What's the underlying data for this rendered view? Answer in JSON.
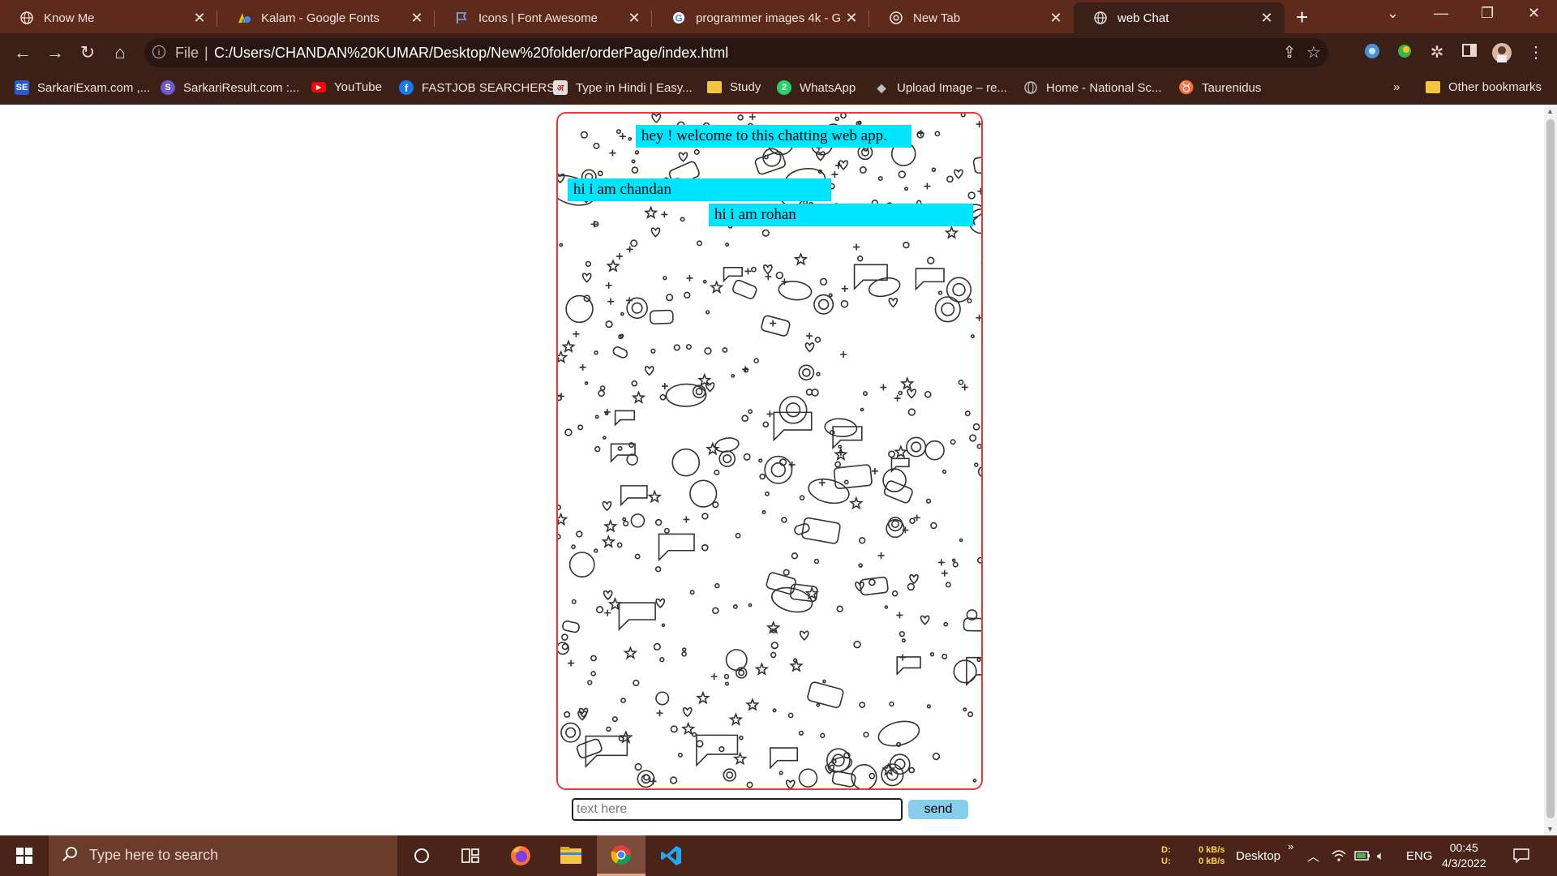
{
  "browser": {
    "tabs": [
      {
        "title": "Know Me",
        "icon": "globe-icon",
        "active": false
      },
      {
        "title": "Kalam - Google Fonts",
        "icon": "google-fonts-icon",
        "active": false
      },
      {
        "title": "Icons | Font Awesome",
        "icon": "flag-icon",
        "active": false
      },
      {
        "title": "programmer images 4k - G",
        "icon": "google-icon",
        "active": false
      },
      {
        "title": "New Tab",
        "icon": "chrome-icon",
        "active": false
      },
      {
        "title": "web Chat",
        "icon": "globe-icon",
        "active": true
      }
    ],
    "address": {
      "scheme_label": "File",
      "url": "C:/Users/CHANDAN%20KUMAR/Desktop/New%20folder/orderPage/index.html"
    },
    "bookmarks": [
      {
        "label": "SarkariExam.com ,...",
        "icon": "se-icon",
        "color": "#2a5bd7"
      },
      {
        "label": "SarkariResult.com :...",
        "icon": "sr-icon",
        "color": "#6a5acd"
      },
      {
        "label": "YouTube",
        "icon": "youtube-icon",
        "color": "#ff0000"
      },
      {
        "label": "FASTJOB SEARCHERS",
        "icon": "facebook-icon",
        "color": "#1877f2"
      },
      {
        "label": "Type in Hindi | Easy...",
        "icon": "hindi-icon",
        "color": "#e0e0e0"
      },
      {
        "label": "Study",
        "icon": "folder-icon",
        "color": "#f5c542"
      },
      {
        "label": "WhatsApp",
        "icon": "whatsapp-icon",
        "color": "#25d366"
      },
      {
        "label": "Upload Image – re...",
        "icon": "upload-icon",
        "color": "#9e9e9e"
      },
      {
        "label": "Home - National Sc...",
        "icon": "globe-icon",
        "color": "#9e9e9e"
      },
      {
        "label": "Taurenidus",
        "icon": "taurus-icon",
        "color": "#3ecf8e"
      }
    ],
    "more_bookmarks": "»",
    "other_bookmarks": "Other bookmarks"
  },
  "chat": {
    "messages": [
      {
        "text": "hey ! welcome to this chatting web app.",
        "side": "center"
      },
      {
        "text": "hi i am chandan",
        "side": "left"
      },
      {
        "text": "hi i am rohan",
        "side": "right"
      }
    ],
    "input": {
      "value": "",
      "placeholder": "text here"
    },
    "send_label": "send",
    "border_color": "#e53935",
    "bubble_color": "#00e5ff",
    "button_color": "#87ceeb"
  },
  "taskbar": {
    "search_placeholder": "Type here to search",
    "apps": [
      "cortana-icon",
      "task-view-icon",
      "firefox-icon",
      "file-explorer-icon",
      "chrome-icon",
      "vscode-icon"
    ],
    "net_download_label": "D:",
    "net_upload_label": "U:",
    "net_download": "0 kB/s",
    "net_upload": "0 kB/s",
    "desktop_label": "Desktop",
    "desktop_chevron": "»",
    "language": "ENG",
    "time": "00:45",
    "date": "4/3/2022"
  }
}
